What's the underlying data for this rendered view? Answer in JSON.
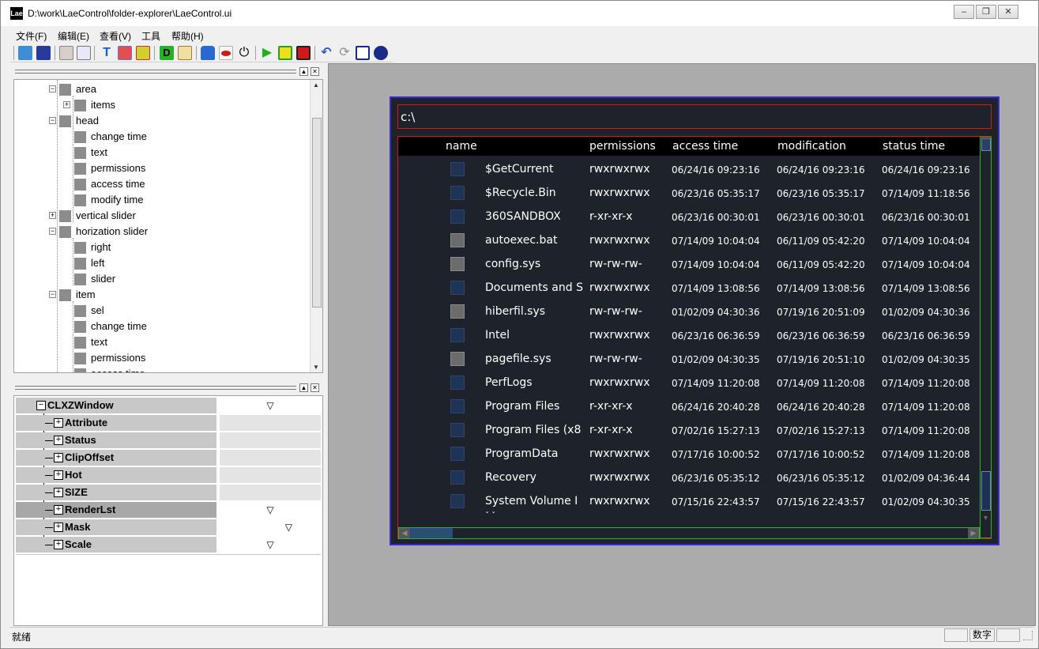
{
  "window": {
    "title": "D:\\work\\LaeControl\\folder-explorer\\LaeControl.ui",
    "app_icon": "Lae",
    "controls": [
      "minimize-icon",
      "restore-icon",
      "close-icon"
    ]
  },
  "menu": {
    "items": [
      "文件(F)",
      "编辑(E)",
      "查看(V)",
      "工具",
      "帮助(H)"
    ]
  },
  "toolbar": {
    "icons": [
      "open-folder-icon",
      "save-icon",
      "edit-image-icon",
      "preview-icon",
      "text-tool-icon",
      "layout-icon",
      "columns-icon",
      "d-icon",
      "wand-icon",
      "lock-icon",
      "eye-icon",
      "power-icon",
      "play-icon",
      "stop-icon",
      "record-icon",
      "undo-icon",
      "refresh-icon",
      "crop-icon",
      "bomb-icon"
    ]
  },
  "tree": {
    "rows": [
      {
        "label": "area",
        "exp": "−"
      },
      {
        "label": "items",
        "exp": "+"
      },
      {
        "label": "head",
        "exp": "−"
      },
      {
        "label": "change time",
        "exp": ""
      },
      {
        "label": "text",
        "exp": ""
      },
      {
        "label": "permissions",
        "exp": ""
      },
      {
        "label": "access time",
        "exp": ""
      },
      {
        "label": "modify time",
        "exp": ""
      },
      {
        "label": "vertical slider",
        "exp": "+"
      },
      {
        "label": "horization slider",
        "exp": "−"
      },
      {
        "label": "right",
        "exp": ""
      },
      {
        "label": "left",
        "exp": ""
      },
      {
        "label": "slider",
        "exp": ""
      },
      {
        "label": "item",
        "exp": "−"
      },
      {
        "label": "sel",
        "exp": ""
      },
      {
        "label": "change time",
        "exp": ""
      },
      {
        "label": "text",
        "exp": ""
      },
      {
        "label": "permissions",
        "exp": ""
      },
      {
        "label": "access time",
        "exp": ""
      }
    ]
  },
  "props": {
    "rows": [
      {
        "name": "CLXZWindow",
        "value": "▽"
      },
      {
        "name": "Attribute",
        "value": ""
      },
      {
        "name": "Status",
        "value": ""
      },
      {
        "name": "ClipOffset",
        "value": ""
      },
      {
        "name": "Hot",
        "value": ""
      },
      {
        "name": "SIZE",
        "value": ""
      },
      {
        "name": "RenderLst",
        "value": "▽"
      },
      {
        "name": "Mask",
        "value": "▽"
      },
      {
        "name": "Scale",
        "value": "▽"
      }
    ]
  },
  "explorer": {
    "path": "c:\\",
    "columns": [
      "name",
      "permissions",
      "access time",
      "modification",
      "status time"
    ],
    "files": [
      {
        "kind": "folder",
        "name": "$GetCurrent",
        "perm": "rwxrwxrwx",
        "access": "06/24/16 09:23:16",
        "mod": "06/24/16 09:23:16",
        "status": "06/24/16 09:23:16"
      },
      {
        "kind": "folder",
        "name": "$Recycle.Bin",
        "perm": "rwxrwxrwx",
        "access": "06/23/16 05:35:17",
        "mod": "06/23/16 05:35:17",
        "status": "07/14/09 11:18:56"
      },
      {
        "kind": "folder",
        "name": "360SANDBOX",
        "perm": "r-xr-xr-x",
        "access": "06/23/16 00:30:01",
        "mod": "06/23/16 00:30:01",
        "status": "06/23/16 00:30:01"
      },
      {
        "kind": "file",
        "name": "autoexec.bat",
        "perm": "rwxrwxrwx",
        "access": "07/14/09 10:04:04",
        "mod": "06/11/09 05:42:20",
        "status": "07/14/09 10:04:04"
      },
      {
        "kind": "file",
        "name": "config.sys",
        "perm": "rw-rw-rw-",
        "access": "07/14/09 10:04:04",
        "mod": "06/11/09 05:42:20",
        "status": "07/14/09 10:04:04"
      },
      {
        "kind": "folder",
        "name": "Documents and S",
        "perm": "rwxrwxrwx",
        "access": "07/14/09 13:08:56",
        "mod": "07/14/09 13:08:56",
        "status": "07/14/09 13:08:56"
      },
      {
        "kind": "file",
        "name": "hiberfil.sys",
        "perm": "rw-rw-rw-",
        "access": "01/02/09 04:30:36",
        "mod": "07/19/16 20:51:09",
        "status": "01/02/09 04:30:36"
      },
      {
        "kind": "folder",
        "name": "Intel",
        "perm": "rwxrwxrwx",
        "access": "06/23/16 06:36:59",
        "mod": "06/23/16 06:36:59",
        "status": "06/23/16 06:36:59"
      },
      {
        "kind": "file",
        "name": "pagefile.sys",
        "perm": "rw-rw-rw-",
        "access": "01/02/09 04:30:35",
        "mod": "07/19/16 20:51:10",
        "status": "01/02/09 04:30:35"
      },
      {
        "kind": "folder",
        "name": "PerfLogs",
        "perm": "rwxrwxrwx",
        "access": "07/14/09 11:20:08",
        "mod": "07/14/09 11:20:08",
        "status": "07/14/09 11:20:08"
      },
      {
        "kind": "folder",
        "name": "Program Files",
        "perm": "r-xr-xr-x",
        "access": "06/24/16 20:40:28",
        "mod": "06/24/16 20:40:28",
        "status": "07/14/09 11:20:08"
      },
      {
        "kind": "folder",
        "name": "Program Files (x8",
        "perm": "r-xr-xr-x",
        "access": "07/02/16 15:27:13",
        "mod": "07/02/16 15:27:13",
        "status": "07/14/09 11:20:08"
      },
      {
        "kind": "folder",
        "name": "ProgramData",
        "perm": "rwxrwxrwx",
        "access": "07/17/16 10:00:52",
        "mod": "07/17/16 10:00:52",
        "status": "07/14/09 11:20:08"
      },
      {
        "kind": "folder",
        "name": "Recovery",
        "perm": "rwxrwxrwx",
        "access": "06/23/16 05:35:12",
        "mod": "06/23/16 05:35:12",
        "status": "01/02/09 04:36:44"
      },
      {
        "kind": "folder",
        "name": "System Volume I",
        "perm": "rwxrwxrwx",
        "access": "07/15/16 22:43:57",
        "mod": "07/15/16 22:43:57",
        "status": "01/02/09 04:30:35"
      }
    ]
  },
  "status": {
    "text": "就绪",
    "num": "数字"
  }
}
